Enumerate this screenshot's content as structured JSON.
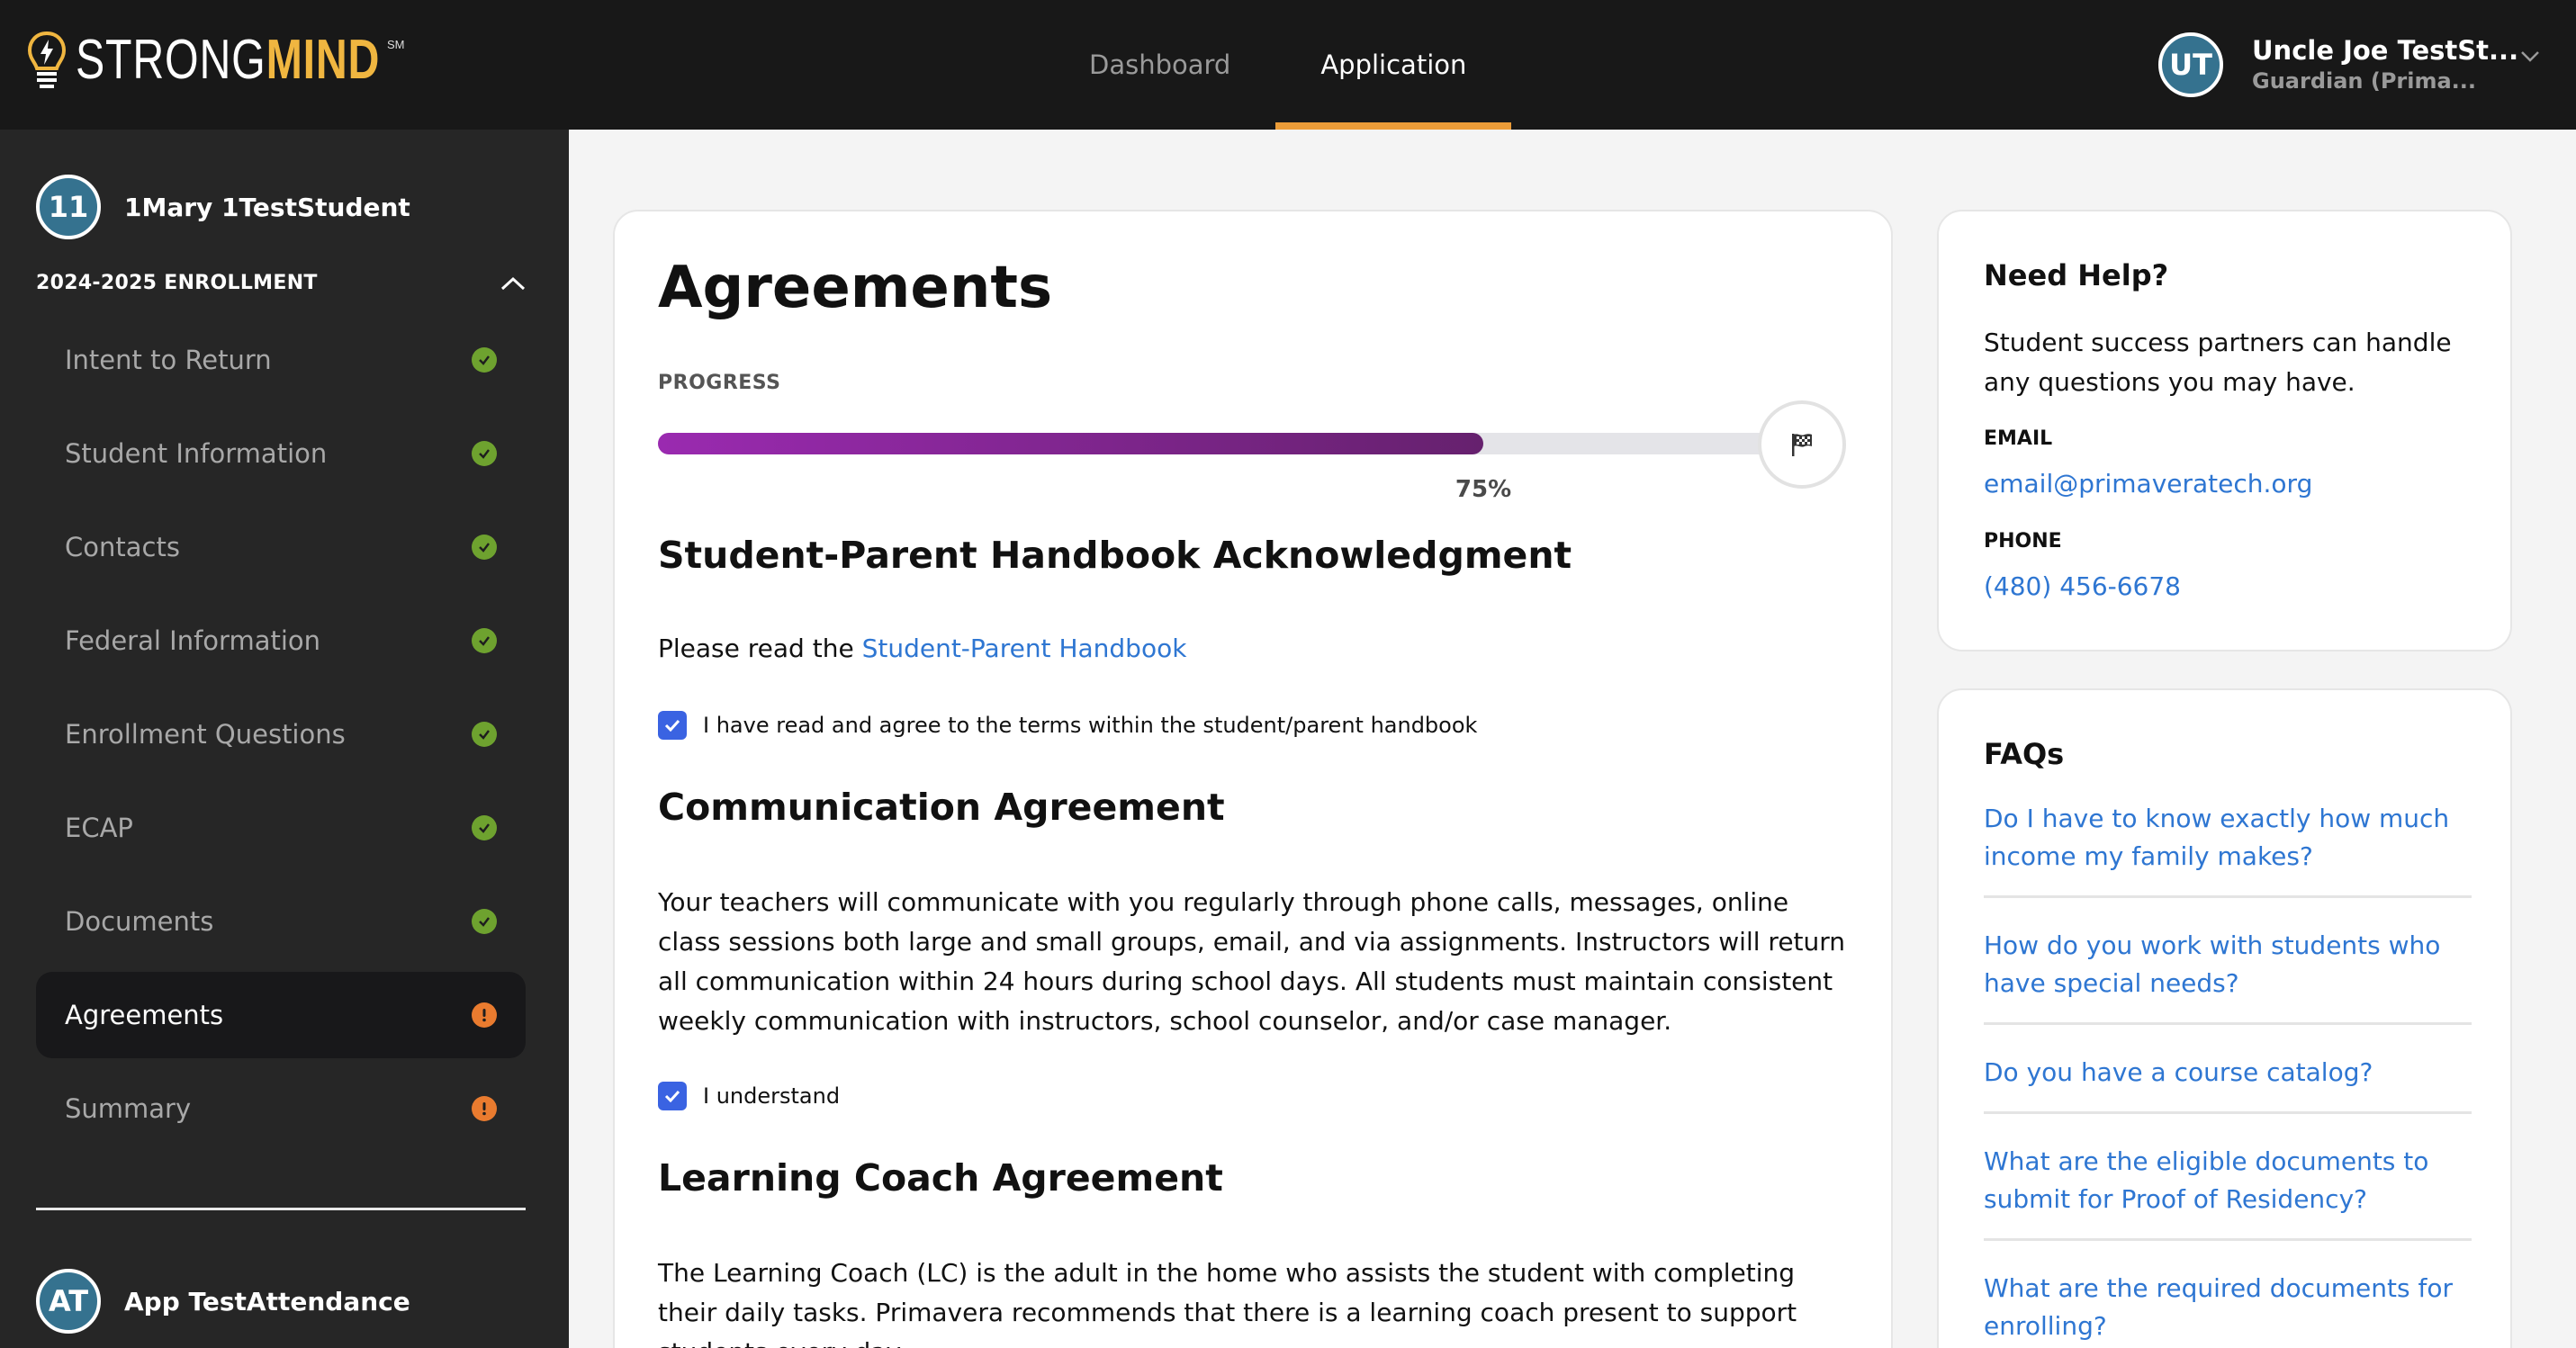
{
  "header": {
    "logo": {
      "text_strong": "STRONG",
      "text_mind": "MIND",
      "service_mark": "SM",
      "icon": "lightbulb-icon"
    },
    "nav": [
      {
        "label": "Dashboard",
        "active": false
      },
      {
        "label": "Application",
        "active": true
      }
    ],
    "user": {
      "initials": "UT",
      "name": "Uncle Joe TestSt...",
      "role": "Guardian (Prima...",
      "menu_icon": "chevron-down-icon"
    }
  },
  "sidebar": {
    "student": {
      "initials": "11",
      "name": "1Mary 1TestStudent"
    },
    "enrollment_title": "2024-2025 ENROLLMENT",
    "items": [
      {
        "label": "Intent to Return",
        "status": "complete"
      },
      {
        "label": "Student Information",
        "status": "complete"
      },
      {
        "label": "Contacts",
        "status": "complete"
      },
      {
        "label": "Federal Information",
        "status": "complete"
      },
      {
        "label": "Enrollment Questions",
        "status": "complete"
      },
      {
        "label": "ECAP",
        "status": "complete"
      },
      {
        "label": "Documents",
        "status": "complete"
      },
      {
        "label": "Agreements",
        "status": "incomplete",
        "active": true
      },
      {
        "label": "Summary",
        "status": "incomplete"
      }
    ],
    "other_student": {
      "initials": "AT",
      "name": "App TestAttendance"
    }
  },
  "main": {
    "title": "Agreements",
    "progress": {
      "label": "PROGRESS",
      "percent": 75,
      "percent_text": "75%",
      "end_icon": "checkered-flag-icon"
    },
    "sections": {
      "handbook": {
        "title": "Student-Parent Handbook Acknowledgment",
        "text_prefix": "Please read the ",
        "link": "Student-Parent Handbook",
        "checkbox_label": "I have read and agree to the terms within the student/parent handbook",
        "checked": true
      },
      "communication": {
        "title": "Communication Agreement",
        "text": "Your teachers will communicate with you regularly through phone calls, messages, online class sessions both large and small groups, email, and via assignments. Instructors will return all communication within 24 hours during school days. All students must maintain consistent weekly communication with instructors, school counselor, and/or case manager.",
        "checkbox_label": "I understand",
        "checked": true
      },
      "learning_coach": {
        "title": "Learning Coach Agreement",
        "text": "The Learning Coach (LC) is the adult in the home who assists the student with completing their daily tasks. Primavera recommends that there is a learning coach present to support students every day."
      }
    }
  },
  "help": {
    "title": "Need Help?",
    "text": "Student success partners can handle any questions you may have.",
    "email_label": "EMAIL",
    "email": "email@primaveratech.org",
    "phone_label": "PHONE",
    "phone": "(480) 456-6678"
  },
  "faqs": {
    "title": "FAQs",
    "items": [
      "Do I have to know exactly how much income my family makes?",
      "How do you work with students who have special needs?",
      "Do you have a course catalog?",
      "What are the eligible documents to submit for Proof of Residency?",
      "What are the required documents for enrolling?"
    ]
  },
  "colors": {
    "header_bg": "#181818",
    "sidebar_bg": "#262626",
    "accent_orange": "#eb9c38",
    "brand_yellow": "#f0b640",
    "progress_start": "#9a2ab0",
    "progress_end": "#66216e",
    "link_blue": "#2e76d2",
    "checkbox_blue": "#3a63e2",
    "status_complete": "#6ea22f",
    "status_incomplete": "#e97b2f",
    "avatar_teal": "#35728f"
  }
}
